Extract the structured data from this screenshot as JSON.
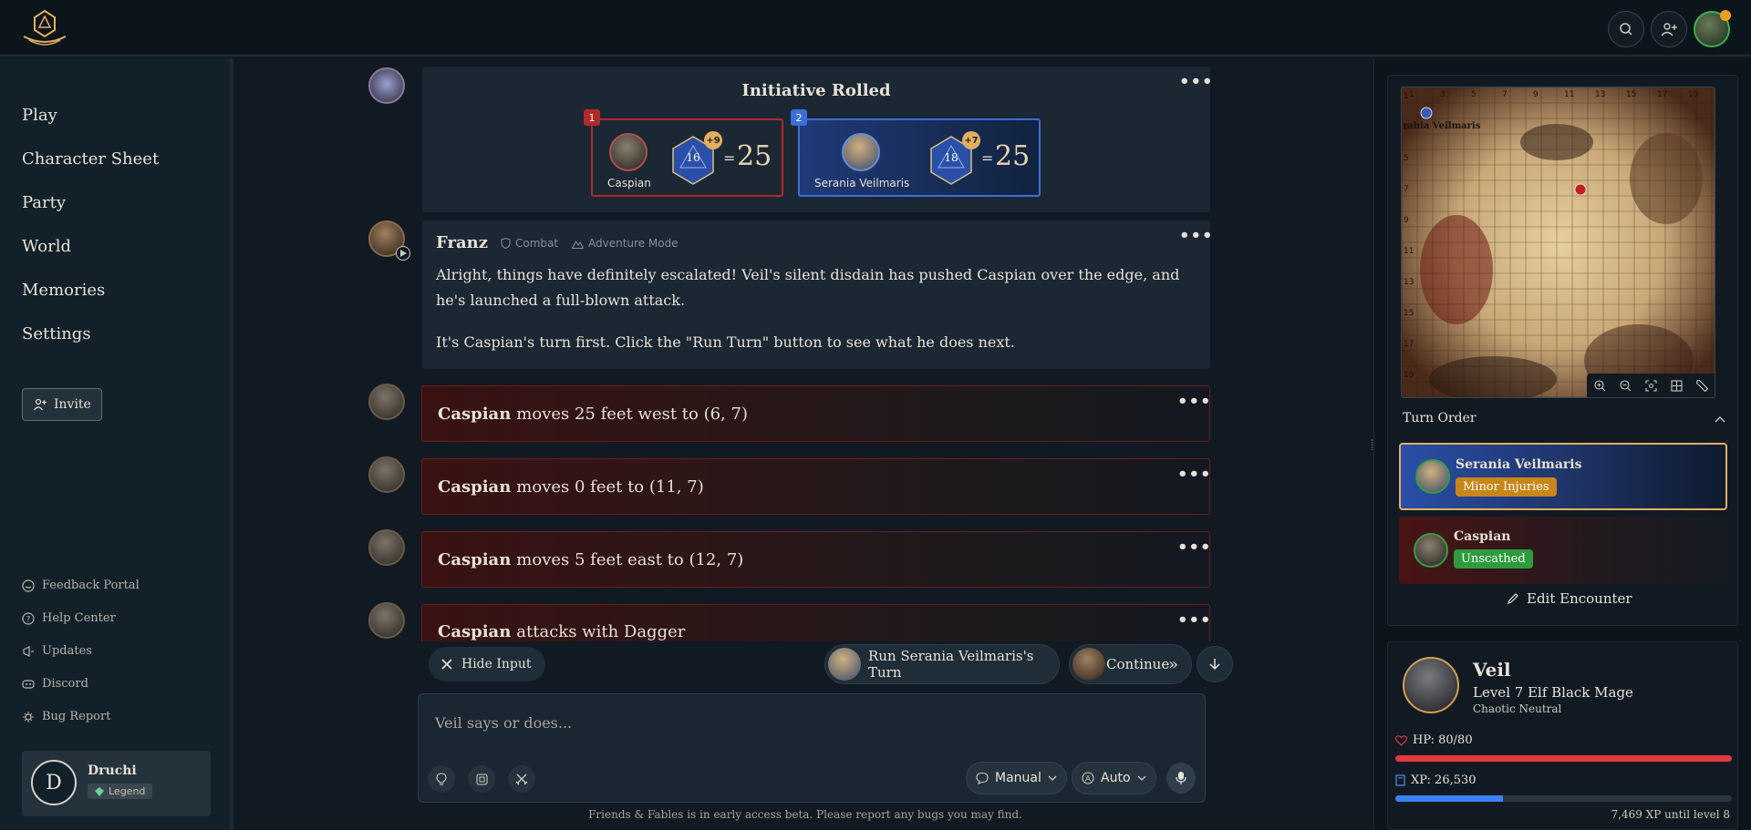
{
  "topbar": {
    "search_label": "",
    "add_user_label": ""
  },
  "sidebar": {
    "nav": [
      {
        "label": "Play"
      },
      {
        "label": "Character Sheet"
      },
      {
        "label": "Party"
      },
      {
        "label": "World"
      },
      {
        "label": "Memories"
      },
      {
        "label": "Settings"
      }
    ],
    "invite_label": "Invite",
    "footer": [
      {
        "label": "Feedback Portal",
        "icon": "feedback-icon"
      },
      {
        "label": "Help Center",
        "icon": "help-icon"
      },
      {
        "label": "Updates",
        "icon": "megaphone-icon"
      },
      {
        "label": "Discord",
        "icon": "discord-icon"
      },
      {
        "label": "Bug Report",
        "icon": "bug-icon"
      }
    ],
    "user": {
      "initial": "D",
      "name": "Druchi",
      "rank": "Legend"
    }
  },
  "chat": {
    "initiative": {
      "title": "Initiative Rolled",
      "entries": [
        {
          "order": "1",
          "name": "Caspian",
          "roll": "16",
          "modifier": "+9",
          "total": "25"
        },
        {
          "order": "2",
          "name": "Serania Veilmaris",
          "roll": "18",
          "modifier": "+7",
          "total": "25"
        }
      ],
      "equals": "="
    },
    "narrator": {
      "name": "Franz",
      "tag_combat": "Combat",
      "tag_mode": "Adventure Mode",
      "paragraph1": "Alright, things have definitely escalated! Veil's silent disdain has pushed Caspian over the edge, and he's launched a full-blown attack.",
      "paragraph2": "It's Caspian's turn first. Click the \"Run Turn\" button to see what he does next."
    },
    "actions": [
      {
        "actor": "Caspian",
        "text": "moves 25 feet west to (6, 7)"
      },
      {
        "actor": "Caspian",
        "text": "moves 0 feet to (11, 7)"
      },
      {
        "actor": "Caspian",
        "text": "moves 5 feet east to (12, 7)"
      },
      {
        "actor": "Caspian",
        "text": "attacks with Dagger"
      }
    ],
    "menu_label": "•••"
  },
  "controls": {
    "hide_input": "Hide Input",
    "run_turn": "Run Serania Veilmaris's Turn",
    "continue": "Continue",
    "continue_glyph": "»"
  },
  "input": {
    "placeholder": "Veil says or does...",
    "mode_manual": "Manual",
    "mode_auto": "Auto"
  },
  "beta_notice": "Friends & Fables is in early access beta. Please report any bugs you may find.",
  "map": {
    "col_labels": [
      "1",
      "3",
      "5",
      "7",
      "9",
      "11",
      "13",
      "15",
      "17",
      "19"
    ],
    "row_labels": [
      "1",
      "3",
      "5",
      "7",
      "9",
      "11",
      "13",
      "15",
      "17",
      "19"
    ],
    "token_label": "rahia Veilmaris"
  },
  "turn_order": {
    "label": "Turn Order",
    "entries": [
      {
        "name": "Serania Veilmaris",
        "status": "Minor Injuries",
        "status_color": "#c9861a",
        "active": true
      },
      {
        "name": "Caspian",
        "status": "Unscathed",
        "status_color": "#2f9a3e",
        "active": false
      }
    ],
    "edit_label": "Edit Encounter"
  },
  "character": {
    "name": "Veil",
    "class_line": "Level 7 Elf Black Mage",
    "alignment": "Chaotic Neutral",
    "hp_label": "HP: 80/80",
    "hp_fraction": 1.0,
    "xp_label": "XP: 26,530",
    "xp_fraction": 0.32,
    "xp_next": "7,469 XP until level 8"
  },
  "colors": {
    "hp_bar": "#e0393e",
    "xp_bar": "#3b82f6",
    "accent_gold": "#e0b060"
  }
}
